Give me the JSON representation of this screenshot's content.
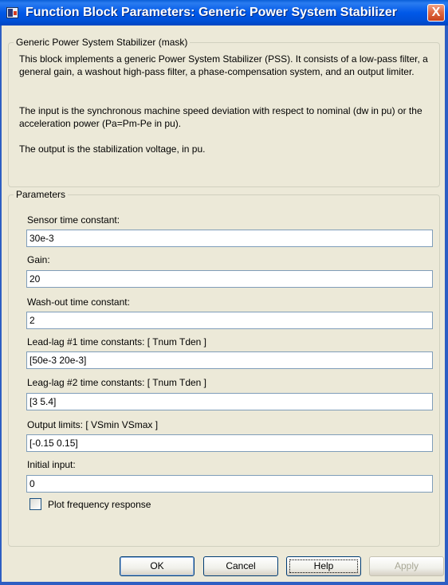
{
  "window": {
    "title": "Function Block Parameters: Generic Power System Stabilizer",
    "close_glyph": "X",
    "icon": "simulink-block-icon"
  },
  "description": {
    "legend": "Generic Power System Stabilizer (mask)",
    "paragraph1": "This block implements a generic Power System Stabilizer (PSS). It consists of a low-pass filter, a general gain, a washout high-pass filter, a phase-compensation system, and an output limiter.",
    "paragraph2": "The input is the synchronous machine speed deviation with respect to nominal (dw in pu) or the acceleration power (Pa=Pm-Pe in pu).",
    "paragraph3": "The output is the stabilization voltage, in pu."
  },
  "parameters": {
    "legend": "Parameters",
    "fields": [
      {
        "label": "Sensor time constant:",
        "value": "30e-3"
      },
      {
        "label": "Gain:",
        "value": "20"
      },
      {
        "label": "Wash-out time constant:",
        "value": "2"
      },
      {
        "label": "Lead-lag #1 time constants: [ Tnum Tden ]",
        "value": "[50e-3 20e-3]"
      },
      {
        "label": "Leag-lag #2 time constants: [ Tnum Tden ]",
        "value": "[3 5.4]"
      },
      {
        "label": "Output limits: [ VSmin VSmax ]",
        "value": "[-0.15 0.15]"
      },
      {
        "label": "Initial input:",
        "value": "0"
      }
    ],
    "checkbox": {
      "label": "Plot frequency response",
      "checked": false
    }
  },
  "buttons": {
    "ok": "OK",
    "cancel": "Cancel",
    "help": "Help",
    "apply": "Apply"
  },
  "colors": {
    "titlebar": "#0058e8",
    "dialog_bg": "#ece9d8",
    "close_button": "#e06a45",
    "input_border": "#7f9db9"
  }
}
